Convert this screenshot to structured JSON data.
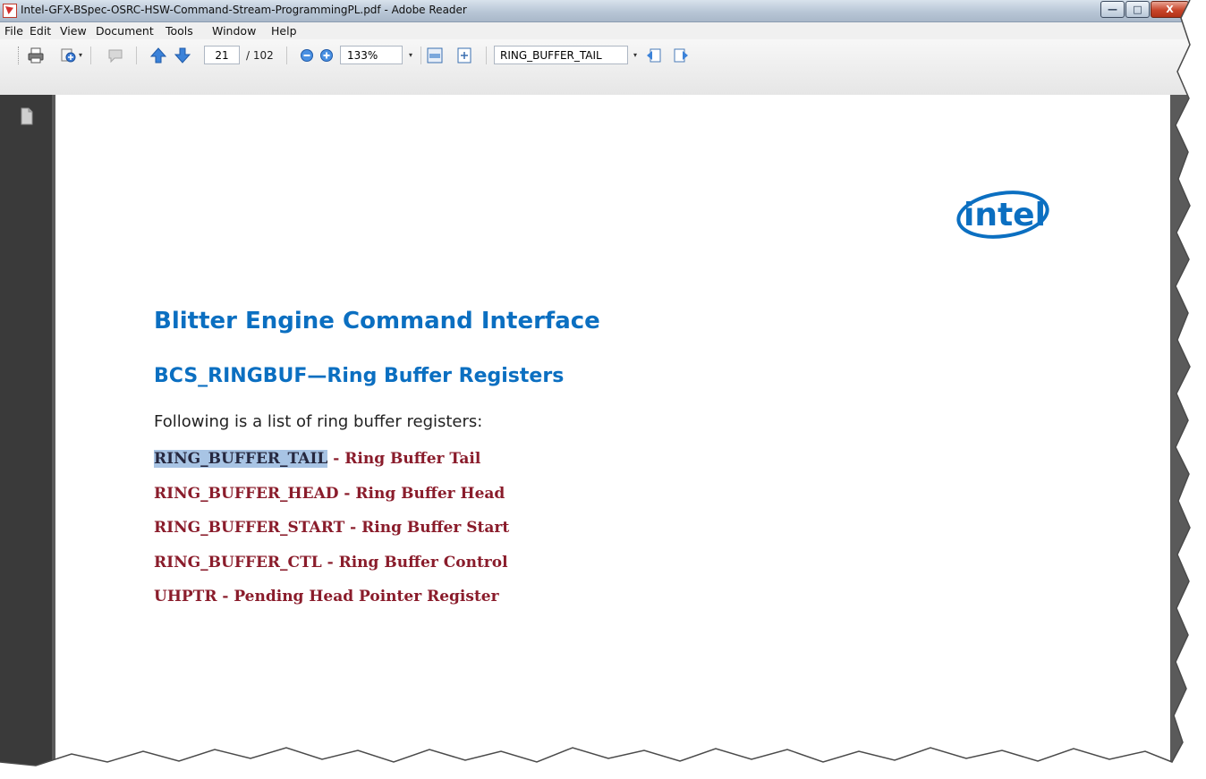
{
  "window": {
    "title": "Intel-GFX-BSpec-OSRC-HSW-Command-Stream-ProgrammingPL.pdf - Adobe Reader",
    "controls": {
      "minimize": "—",
      "maximize": "□",
      "close": "X"
    }
  },
  "menu": {
    "items": [
      "File",
      "Edit",
      "View",
      "Document",
      "Tools",
      "Window",
      "Help"
    ]
  },
  "toolbar": {
    "page_number": "21",
    "page_total": "/ 102",
    "zoom": "133%",
    "search_text": "RING_BUFFER_TAIL",
    "icons": [
      "print-icon",
      "share-icon",
      "comment-icon",
      "previous-page-icon",
      "next-page-icon",
      "zoom-out-icon",
      "zoom-in-icon",
      "fit-width-icon",
      "fit-page-icon",
      "find-previous-icon",
      "find-next-icon"
    ]
  },
  "document": {
    "logo_text": "intel",
    "heading": "Blitter Engine Command Interface",
    "subheading": "BCS_RINGBUF—Ring Buffer Registers",
    "intro": "Following is a list of ring buffer registers:",
    "registers": [
      {
        "name": "RING_BUFFER_TAIL",
        "rest": " - Ring Buffer Tail",
        "highlighted": true
      },
      {
        "name": "RING_BUFFER_HEAD",
        "rest": " - Ring Buffer Head",
        "highlighted": false
      },
      {
        "name": "RING_BUFFER_START",
        "rest": " - Ring Buffer Start",
        "highlighted": false
      },
      {
        "name": "RING_BUFFER_CTL",
        "rest": " - Ring Buffer Control",
        "highlighted": false
      },
      {
        "name": "UHPTR",
        "rest": " - Pending Head Pointer Register",
        "highlighted": false
      }
    ]
  },
  "colors": {
    "heading": "#0b6fc1",
    "link": "#8a1c2b",
    "highlight": "#a8c4e4",
    "logo": "#0b6fc1"
  }
}
